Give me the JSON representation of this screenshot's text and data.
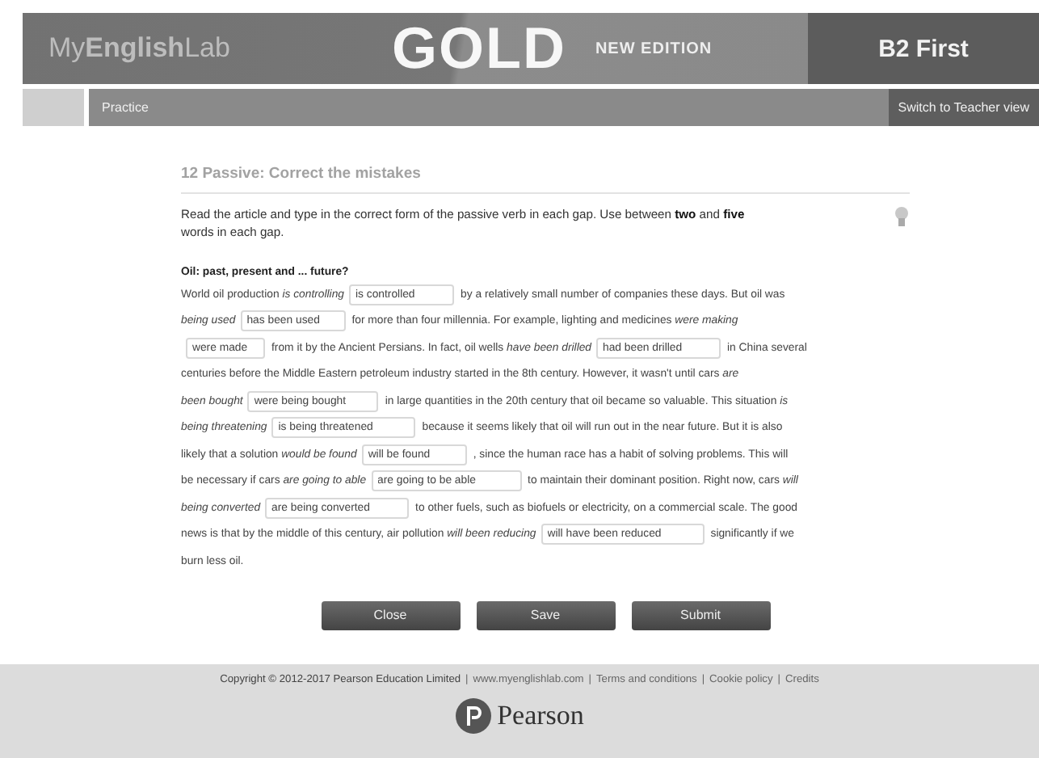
{
  "header": {
    "brand": "My**English**Lab",
    "title": "GOLD",
    "edition": "NEW EDITION",
    "level": "B2 First"
  },
  "nav": {
    "section": "Practice",
    "switch_button": "Switch to Teacher view"
  },
  "exercise": {
    "title": "12 Passive: Correct the mistakes",
    "instructions": "Read the article and type in the correct form of the passive verb in each gap. Use between **two** and **five** words in each gap.",
    "article_title": "Oil: past, present and ... future?",
    "lines": [
      [
        {
          "kind": "text",
          "text": "World oil production *is controlling*"
        },
        {
          "kind": "gap",
          "value": "is controlled"
        },
        {
          "kind": "text",
          "text": "by a relatively small number of companies these days. But oil was"
        }
      ],
      [
        {
          "kind": "text",
          "text": "*being used*"
        },
        {
          "kind": "gap",
          "value": "has been used"
        },
        {
          "kind": "text",
          "text": "for more than four millennia. For example, lighting and medicines *were making*"
        }
      ],
      [
        {
          "kind": "gap",
          "value": "were made"
        },
        {
          "kind": "text",
          "text": "from it by the Ancient Persians. In fact, oil wells *have been drilled*"
        },
        {
          "kind": "gap",
          "value": "had been drilled"
        },
        {
          "kind": "text",
          "text": "in China several"
        }
      ],
      [
        {
          "kind": "text",
          "text": "centuries before the Middle Eastern petroleum industry started in the 8th century. However, it wasn't until cars *are*"
        }
      ],
      [
        {
          "kind": "text",
          "text": "*been bought*"
        },
        {
          "kind": "gap",
          "value": "were being bought"
        },
        {
          "kind": "text",
          "text": "in large quantities in the 20th century that oil became so valuable. This situation *is*"
        }
      ],
      [
        {
          "kind": "text",
          "text": "*being threatening*"
        },
        {
          "kind": "gap",
          "value": "is being threatened"
        },
        {
          "kind": "text",
          "text": "because it seems likely that oil will run out in the near future. But it is also"
        }
      ],
      [
        {
          "kind": "text",
          "text": "likely that a solution *would be found*"
        },
        {
          "kind": "gap",
          "value": "will be found"
        },
        {
          "kind": "text",
          "text": ", since the human race has a habit of solving problems. This will"
        }
      ],
      [
        {
          "kind": "text",
          "text": "be necessary if cars *are going to able*"
        },
        {
          "kind": "gap",
          "value": "are going to be able"
        },
        {
          "kind": "text",
          "text": "to maintain their dominant position. Right now, cars *will*"
        }
      ],
      [
        {
          "kind": "text",
          "text": "*being converted*"
        },
        {
          "kind": "gap",
          "value": "are being converted"
        },
        {
          "kind": "text",
          "text": "to other fuels, such as biofuels or electricity, on a commercial scale. The good"
        }
      ],
      [
        {
          "kind": "text",
          "text": "news is that by the middle of this century, air pollution *will been reducing*"
        },
        {
          "kind": "gap",
          "value": "will have been reduced"
        },
        {
          "kind": "text",
          "text": "significantly if we"
        }
      ],
      [
        {
          "kind": "text",
          "text": "burn less oil."
        }
      ]
    ],
    "buttons": [
      "Close",
      "Save",
      "Submit"
    ]
  },
  "footer": {
    "links": [
      {
        "kind": "text",
        "label": "Copyright © 2012-2017 Pearson Education Limited"
      },
      {
        "kind": "separator",
        "label": "|"
      },
      {
        "kind": "link",
        "label": "www.myenglishlab.com"
      },
      {
        "kind": "separator",
        "label": "|"
      },
      {
        "kind": "link",
        "label": "Terms and conditions"
      },
      {
        "kind": "separator",
        "label": "|"
      },
      {
        "kind": "link",
        "label": "Cookie policy"
      },
      {
        "kind": "separator",
        "label": "|"
      },
      {
        "kind": "link",
        "label": "Credits"
      }
    ],
    "logo": "Pearson"
  }
}
